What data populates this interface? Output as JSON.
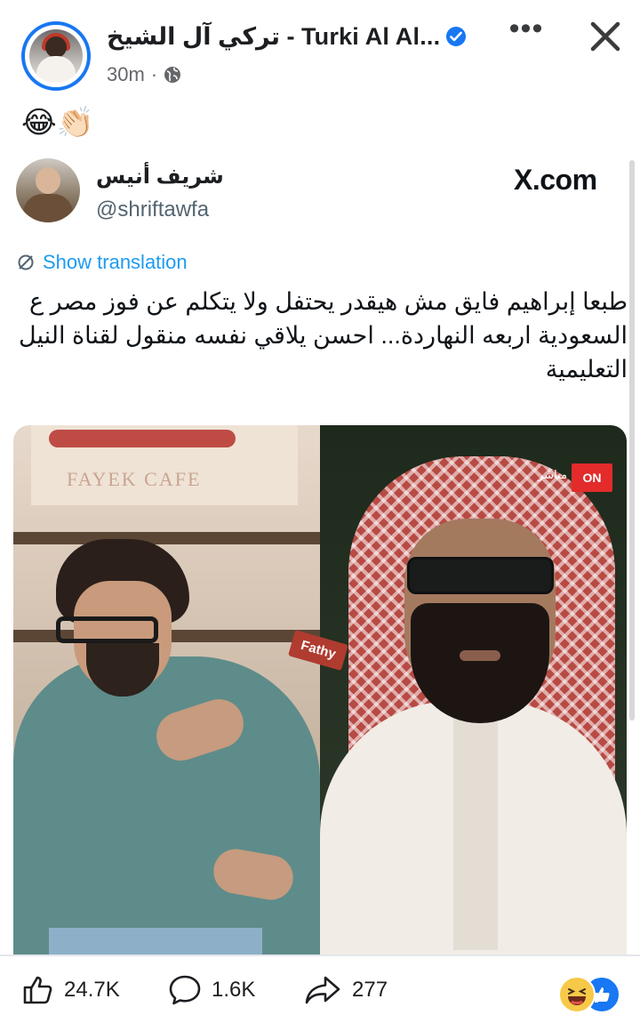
{
  "post": {
    "page_name": "تركي آل الشيخ - Turki Al Al...",
    "time": "30m",
    "privacy_icon": "globe-icon",
    "more_label": "•••",
    "caption": "😂👏🏻"
  },
  "tweet": {
    "author_name": "شريف أنيس",
    "handle": "@shriftawfa",
    "source": "X.com",
    "translate_label": "Show translation",
    "text": "طبعا إبراهيم فايق مش هيقدر يحتفل ولا يتكلم عن فوز مصر ع السعودية اربعه النهاردة... احسن يلاقي نفسه منقول لقناة النيل التعليمية",
    "image": {
      "sign_text": "FAYEK CAFE",
      "tag_text": "Fathy",
      "channel_badge": "ON",
      "live_text": "مباشر"
    }
  },
  "engagement": {
    "likes": "24.7K",
    "comments": "1.6K",
    "shares": "277"
  },
  "colors": {
    "accent": "#1877f2",
    "link": "#1d9bf0",
    "muted": "#65676b"
  }
}
